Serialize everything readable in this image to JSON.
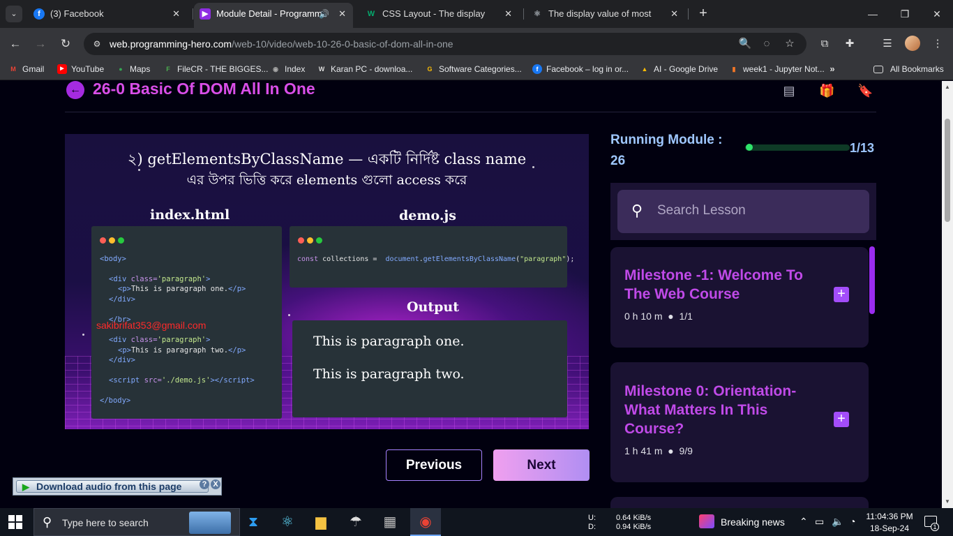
{
  "browser": {
    "tabs": [
      {
        "title": "(3) Facebook",
        "favicon": "facebook-icon",
        "color": "#1877f2"
      },
      {
        "title": "Module Detail - Programming",
        "favicon": "programming-hero-icon",
        "color": "#8e2de2",
        "active": true
      },
      {
        "title": "CSS Layout - The display Proper",
        "favicon": "w3schools-icon",
        "color": "#04aa6d"
      },
      {
        "title": "The display value of most DOM",
        "favicon": "react-icon",
        "color": "#555555"
      }
    ],
    "url_host": "web.programming-hero.com",
    "url_path": "/web-10/video/web-10-26-0-basic-of-dom-all-in-one",
    "bookmarks": [
      {
        "label": "Gmail",
        "icon": "gmail-icon"
      },
      {
        "label": "YouTube",
        "icon": "youtube-icon"
      },
      {
        "label": "Maps",
        "icon": "maps-icon"
      },
      {
        "label": "FileCR - THE BIGGES...",
        "icon": "filecr-icon"
      },
      {
        "label": "Index",
        "icon": "index-icon"
      },
      {
        "label": "Karan PC - downloa...",
        "icon": "wordpress-icon"
      },
      {
        "label": "Software Categories...",
        "icon": "google-icon"
      },
      {
        "label": "Facebook – log in or...",
        "icon": "facebook-icon"
      },
      {
        "label": "AI - Google Drive",
        "icon": "drive-icon"
      },
      {
        "label": "week1 - Jupyter Not...",
        "icon": "jupyter-icon"
      }
    ],
    "all_bookmarks": "All Bookmarks"
  },
  "page": {
    "title": "26-0 Basic Of DOM All In One",
    "video": {
      "heading_line1": "২) getElementsByClassName — একটি নির্দিষ্ট class name",
      "heading_line2": "এর উপর ভিত্তি করে elements গুলো access করে",
      "label_html": "index.html",
      "label_js": "demo.js",
      "label_output": "Output",
      "watermark": "sakibrifat353@gmail.com",
      "output_lines": [
        "This is paragraph one.",
        "This is paragraph two."
      ]
    },
    "buttons": {
      "previous": "Previous",
      "next": "Next"
    }
  },
  "sidebar": {
    "running_label": "Running Module :",
    "running_value": "26",
    "progress_text": "1/13",
    "progress_fraction": 0.077,
    "search_placeholder": "Search Lesson",
    "milestones": [
      {
        "title": "Milestone -1: Welcome To The Web Course",
        "duration": "0 h 10 m",
        "progress": "1/1"
      },
      {
        "title": "Milestone 0: Orientation-What Matters In This Course?",
        "duration": "1 h 41 m",
        "progress": "9/9"
      }
    ]
  },
  "extension": {
    "download_label": "Download audio from this page",
    "help": "?",
    "close": "X"
  },
  "taskbar": {
    "search_text": "Type here to search",
    "net_up_label": "U:",
    "net_up": "0.64 KiB/s",
    "net_down_label": "D:",
    "net_down": "0.94 KiB/s",
    "news": "Breaking news",
    "time": "11:04:36 PM",
    "date": "18-Sep-24",
    "notifications": "1"
  }
}
